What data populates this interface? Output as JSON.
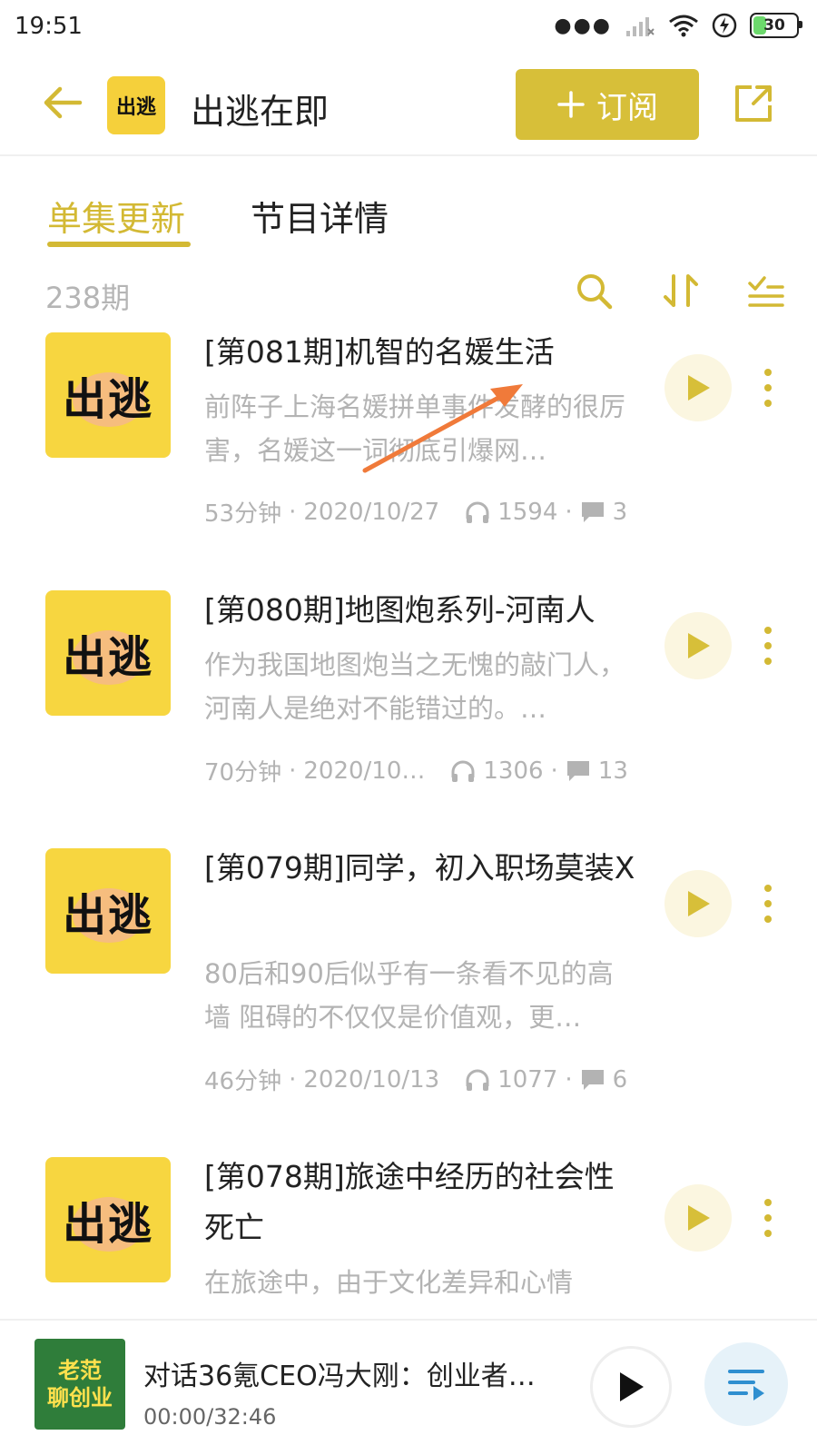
{
  "status": {
    "time": "19:51",
    "battery": "30"
  },
  "header": {
    "title": "出逃在即",
    "logo_text": "出逃",
    "subscribe_label": "订阅"
  },
  "tabs": [
    {
      "label": "单集更新"
    },
    {
      "label": "节目详情"
    }
  ],
  "episode_count": "238期",
  "episodes": [
    {
      "title": "[第081期]机智的名媛生活",
      "desc": "前阵子上海名媛拼单事件发酵的很厉害，名媛这一词彻底引爆网…",
      "duration": "53分钟",
      "date": "2020/10/27",
      "plays": "1594",
      "comments": "3",
      "thumb": "出逃"
    },
    {
      "title": "[第080期]地图炮系列-河南人",
      "desc": "作为我国地图炮当之无愧的敲门人，河南人是绝对不能错过的。…",
      "duration": "70分钟",
      "date": "2020/10…",
      "plays": "1306",
      "comments": "13",
      "thumb": "出逃"
    },
    {
      "title": "[第079期]同学，初入职场莫装X",
      "desc": "80后和90后似乎有一条看不见的高墙 阻碍的不仅仅是价值观，更…",
      "duration": "46分钟",
      "date": "2020/10/13",
      "plays": "1077",
      "comments": "6",
      "thumb": "出逃"
    },
    {
      "title": "[第078期]旅途中经历的社会性死亡",
      "desc": "在旅途中，由于文化差异和心情",
      "thumb": "出逃"
    }
  ],
  "player": {
    "cover_line1": "老范",
    "cover_line2": "聊创业",
    "title": "对话36氪CEO冯大刚：创业者…",
    "time": "00:00/32:46"
  },
  "colors": {
    "accent": "#d3b934",
    "thumb_bg": "#f7d640",
    "arrow": "#f07a3a"
  }
}
